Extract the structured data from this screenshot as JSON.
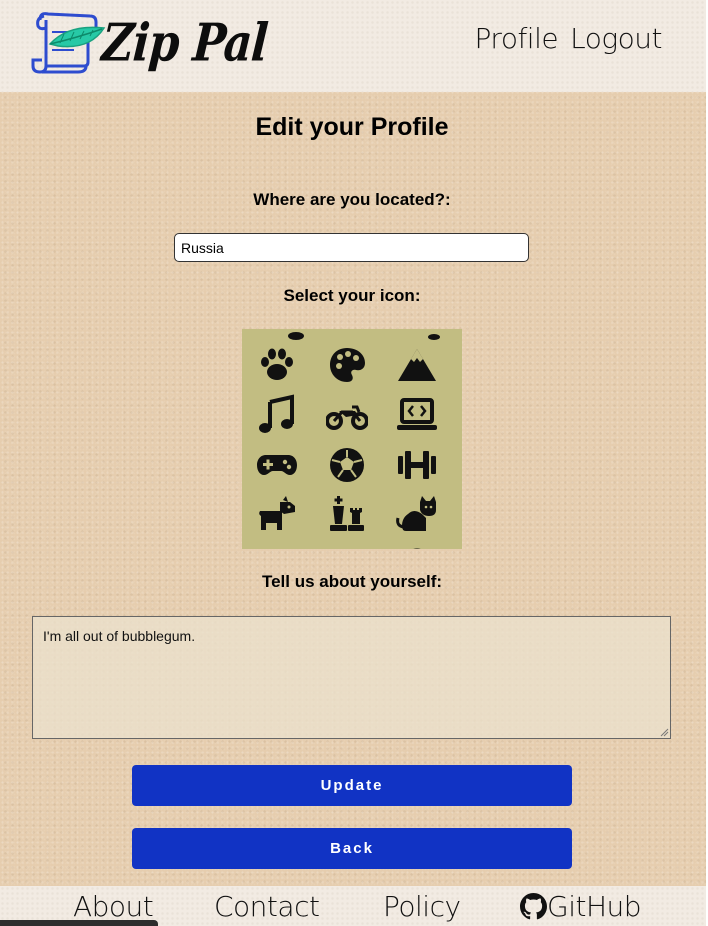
{
  "header": {
    "app_name": "Zip Pal",
    "nav": [
      {
        "label": "Profile"
      },
      {
        "label": "Logout"
      }
    ]
  },
  "main": {
    "title": "Edit your Profile",
    "location_label": "Where are you located?:",
    "location_value": "Russia",
    "icon_label": "Select your icon:",
    "icons": [
      "paw-icon",
      "palette-icon",
      "mountain-icon",
      "music-note-icon",
      "motorcycle-icon",
      "laptop-code-icon",
      "gamepad-icon",
      "soccer-ball-icon",
      "dumbbell-icon",
      "dog-icon",
      "chess-icon",
      "cat-icon"
    ],
    "about_label": "Tell us about yourself:",
    "about_value": "I'm all out of bubblegum.",
    "update_label": "Update",
    "back_label": "Back"
  },
  "footer": {
    "links": [
      {
        "label": "About"
      },
      {
        "label": "Contact"
      },
      {
        "label": "Policy"
      },
      {
        "label": "GitHub"
      }
    ]
  },
  "colors": {
    "button": "#1133c4",
    "icon_grid_bg": "#c2bd82",
    "page_bg": "#e5ccac",
    "header_bg": "#f2ebe3"
  }
}
